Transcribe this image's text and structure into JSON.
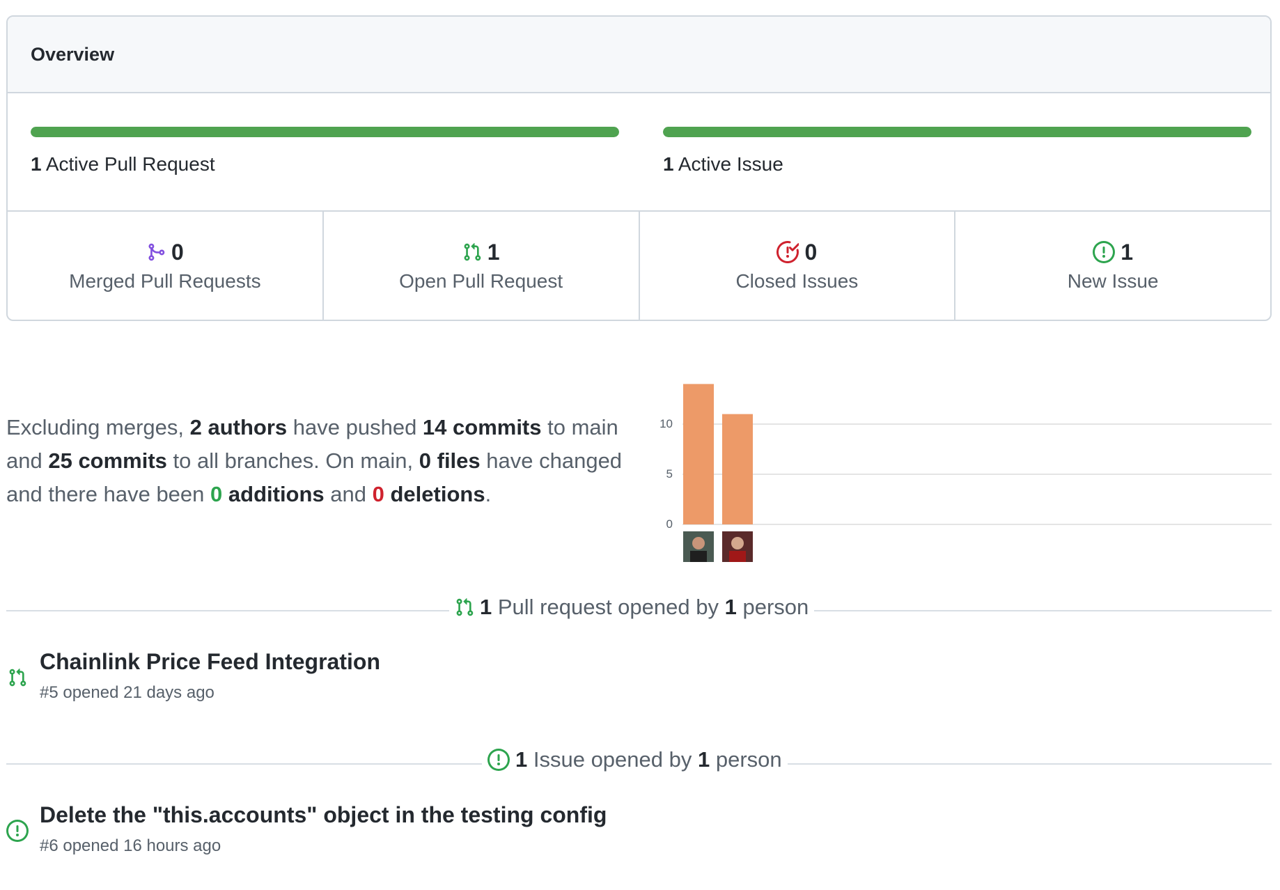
{
  "overview": {
    "title": "Overview",
    "pull_requests": {
      "count": "1",
      "label": "Active Pull Request",
      "bar_fill": 1.0
    },
    "issues": {
      "count": "1",
      "label": "Active Issue",
      "bar_fill": 1.0
    },
    "stats": [
      {
        "icon": "git-merge-icon",
        "count": "0",
        "label": "Merged Pull Requests",
        "color": "#8250df"
      },
      {
        "icon": "git-pull-request-icon",
        "count": "1",
        "label": "Open Pull Request",
        "color": "#2da44e"
      },
      {
        "icon": "issue-closed-icon",
        "count": "0",
        "label": "Closed Issues",
        "color": "#cf222e"
      },
      {
        "icon": "issue-opened-icon",
        "count": "1",
        "label": "New Issue",
        "color": "#2da44e"
      }
    ],
    "colors": {
      "progress_green": "#4fa350",
      "border": "#d0d7de"
    }
  },
  "commit_summary": {
    "t1": "Excluding merges, ",
    "authors": "2 authors",
    "t2": " have pushed ",
    "commits_main": "14 commits",
    "t3": " to main and ",
    "commits_all": "25 commits",
    "t4": " to all branches. On main, ",
    "files": "0 files",
    "t5": " have changed and there have been ",
    "additions_num": "0",
    "additions_word": " additions",
    "t6": " and ",
    "deletions_num": "0",
    "deletions_word": " deletions",
    "t7": "."
  },
  "chart_data": {
    "type": "bar",
    "categories": [
      "author-1",
      "author-2"
    ],
    "values": [
      14,
      11
    ],
    "y_ticks": [
      "0",
      "5",
      "10"
    ],
    "ylim": [
      0,
      14
    ],
    "bar_color": "#ed9a68",
    "grid": true,
    "x_tick_images": [
      "avatar",
      "avatar"
    ]
  },
  "pull_request_section": {
    "count": "1",
    "text_mid": " Pull request opened by ",
    "people": "1",
    "text_end": " person",
    "items": [
      {
        "title": "Chainlink Price Feed Integration",
        "meta": "#5 opened 21 days ago"
      }
    ]
  },
  "issue_section": {
    "count": "1",
    "text_mid": " Issue opened by ",
    "people": "1",
    "text_end": " person",
    "items": [
      {
        "title": "Delete the \"this.accounts\" object in the testing config",
        "meta": "#6 opened 16 hours ago"
      }
    ]
  }
}
